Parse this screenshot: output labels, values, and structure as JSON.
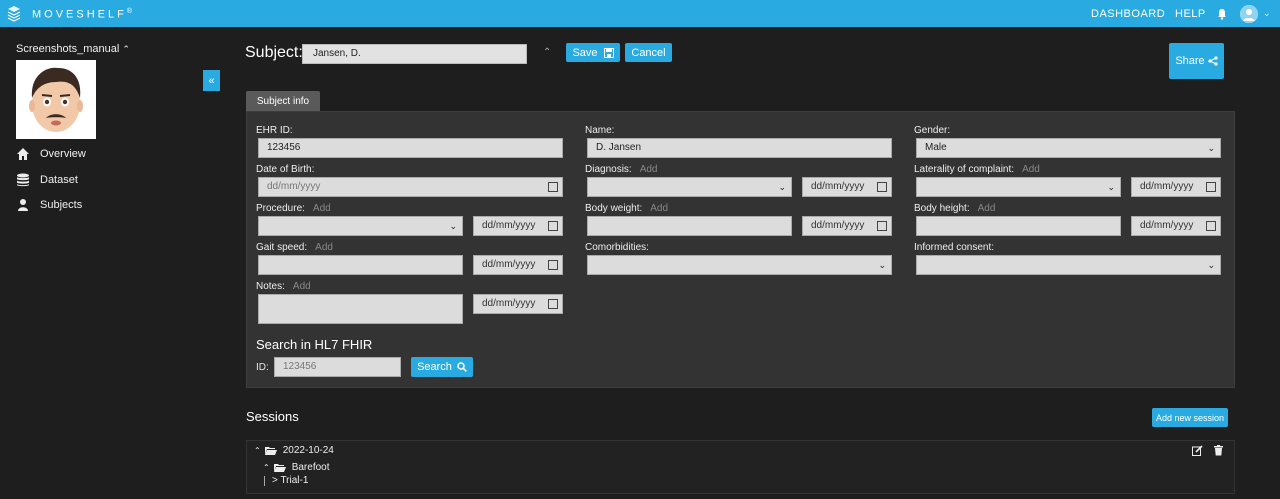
{
  "app": {
    "brand": "MOVESHELF",
    "trademark": "®"
  },
  "topnav": {
    "dashboard": "DASHBOARD",
    "help": "HELP"
  },
  "sidebar": {
    "project": "Screenshots_manual",
    "items": [
      {
        "label": "Overview",
        "icon": "home-icon"
      },
      {
        "label": "Dataset",
        "icon": "database-icon"
      },
      {
        "label": "Subjects",
        "icon": "user-icon"
      }
    ],
    "collapse": "«"
  },
  "header": {
    "subject_label": "Subject:",
    "subject_value": "Jansen, D.",
    "save": "Save",
    "cancel": "Cancel",
    "share": "Share"
  },
  "tab": "Subject info",
  "form": {
    "add": "Add",
    "date_placeholder": "dd/mm/yyyy",
    "ehr_label": "EHR ID:",
    "ehr_value": "123456",
    "name_label": "Name:",
    "name_value": "D. Jansen",
    "gender_label": "Gender:",
    "gender_value": "Male",
    "dob_label": "Date of Birth:",
    "diagnosis_label": "Diagnosis:",
    "laterality_label": "Laterality of complaint:",
    "procedure_label": "Procedure:",
    "weight_label": "Body weight:",
    "height_label": "Body height:",
    "gait_label": "Gait speed:",
    "comorb_label": "Comorbidities:",
    "consent_label": "Informed consent:",
    "notes_label": "Notes:"
  },
  "hl7": {
    "title": "Search in HL7 FHIR",
    "id_label": "ID:",
    "id_placeholder": "123456",
    "search": "Search"
  },
  "sessions": {
    "title": "Sessions",
    "add": "Add new session",
    "tree": {
      "date": "2022-10-24",
      "condition": "Barefoot",
      "trial": "> Trial-1"
    }
  },
  "colors": {
    "accent": "#29abe2",
    "background": "#1e1e1e",
    "panel": "#333333"
  }
}
